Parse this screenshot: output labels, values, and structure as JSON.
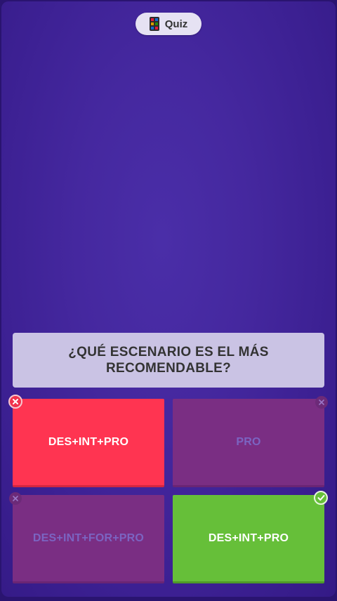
{
  "header": {
    "badge_label": "Quiz",
    "badge_icon": "quiz-app-icon"
  },
  "question": {
    "text": "¿QUÉ ESCENARIO ES EL MÁS RECOMENDABLE?"
  },
  "answers": [
    {
      "label": "DES+INT+PRO",
      "state": "selected-wrong",
      "mark": "x-icon"
    },
    {
      "label": "PRO",
      "state": "wrong",
      "mark": "x-icon"
    },
    {
      "label": "DES+INT+FOR+PRO",
      "state": "wrong",
      "mark": "x-icon"
    },
    {
      "label": "DES+INT+PRO",
      "state": "correct",
      "mark": "check-icon"
    }
  ],
  "colors": {
    "background": "#3d2194",
    "question_panel": "#cac3e4",
    "selected_wrong": "#ff3451",
    "dim_answer": "#7a2e83",
    "correct": "#66bf39"
  }
}
